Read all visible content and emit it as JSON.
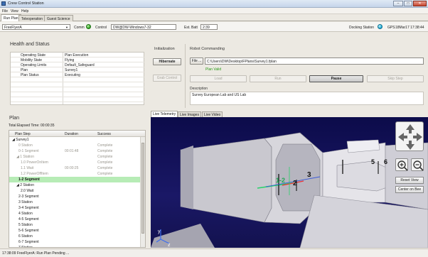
{
  "window": {
    "title": "Crew Control Station",
    "min": "–",
    "max": "□",
    "close": "✕"
  },
  "menu": [
    "File",
    "View",
    "Help"
  ],
  "tabs": [
    {
      "label": "Run Plan",
      "active": true
    },
    {
      "label": "Teleoperation",
      "active": false
    },
    {
      "label": "Guest Science",
      "active": false
    }
  ],
  "toolbar": {
    "robot_select": "FreeFlyerA",
    "comm_label": "Comm",
    "control_label": "Control",
    "control_value": "DW@DW-Windows7-32",
    "estbatt_label": "Est. Batt",
    "estbatt_value": "2:39",
    "docking_label": "Docking Station",
    "gps_label": "GPS",
    "gps_value": "18Mar17 17:38:44",
    "comm_color": "#2aa21a",
    "dock_color": "#13a7d4"
  },
  "health": {
    "title": "Health and Status",
    "rows": [
      {
        "label": "Operating State",
        "value": "Plan Execution"
      },
      {
        "label": "Mobility State",
        "value": "Flying"
      },
      {
        "label": "Operating Limits",
        "value": "Default_Safeguard"
      },
      {
        "label": "Plan",
        "value": "Survey1"
      },
      {
        "label": "Plan Status",
        "value": "Executing"
      }
    ]
  },
  "initialization": {
    "title": "Initialization",
    "hibernate": "Hibernate",
    "grab_control": "Grab Control"
  },
  "robot_cmd": {
    "title": "Robot Commanding",
    "file_button": "File ...",
    "file_path": "C:\\Users\\DW\\Desktop\\FPlans\\Survey1.fplan",
    "plan_valid": "Plan Valid",
    "buttons": {
      "load": "Load",
      "run": "Run",
      "pause": "Pause",
      "skip": "Skip Step"
    },
    "description_label": "Description",
    "description": "Survey European Lab and US Lab"
  },
  "plan": {
    "title": "Plan",
    "elapsed": "Total Elapsed Time: 00:00:35",
    "columns": [
      "Plan Step",
      "Duration",
      "Success"
    ],
    "rows": [
      {
        "step": "◢ Survey1",
        "duration": "",
        "success": "",
        "indent": 0,
        "grey": false,
        "sel": false
      },
      {
        "step": "0 Station",
        "duration": "",
        "success": "Complete",
        "indent": 3,
        "grey": true,
        "sel": false
      },
      {
        "step": "0-1 Segment",
        "duration": "00:01:48",
        "success": "Complete",
        "indent": 3,
        "grey": true,
        "sel": false
      },
      {
        "step": "◢ 1 Station",
        "duration": "",
        "success": "Complete",
        "indent": 2,
        "grey": true,
        "sel": false
      },
      {
        "step": "1.0 PowerOnItem",
        "duration": "",
        "success": "Complete",
        "indent": 4,
        "grey": true,
        "sel": false
      },
      {
        "step": "1.1 Wait",
        "duration": "00:00:25",
        "success": "Complete",
        "indent": 4,
        "grey": true,
        "sel": false
      },
      {
        "step": "1.2 PowerOffItem",
        "duration": "",
        "success": "Complete",
        "indent": 4,
        "grey": true,
        "sel": false
      },
      {
        "step": "1-2 Segment",
        "duration": "",
        "success": "",
        "indent": 3,
        "grey": false,
        "sel": true
      },
      {
        "step": "◢ 2 Station",
        "duration": "",
        "success": "",
        "indent": 2,
        "grey": false,
        "sel": false
      },
      {
        "step": "2.0 Wait",
        "duration": "",
        "success": "",
        "indent": 4,
        "grey": false,
        "sel": false
      },
      {
        "step": "2-3 Segment",
        "duration": "",
        "success": "",
        "indent": 3,
        "grey": false,
        "sel": false
      },
      {
        "step": "3 Station",
        "duration": "",
        "success": "",
        "indent": 3,
        "grey": false,
        "sel": false
      },
      {
        "step": "3-4 Segment",
        "duration": "",
        "success": "",
        "indent": 3,
        "grey": false,
        "sel": false
      },
      {
        "step": "4 Station",
        "duration": "",
        "success": "",
        "indent": 3,
        "grey": false,
        "sel": false
      },
      {
        "step": "4-5 Segment",
        "duration": "",
        "success": "",
        "indent": 3,
        "grey": false,
        "sel": false
      },
      {
        "step": "5 Station",
        "duration": "",
        "success": "",
        "indent": 3,
        "grey": false,
        "sel": false
      },
      {
        "step": "5-6 Segment",
        "duration": "",
        "success": "",
        "indent": 3,
        "grey": false,
        "sel": false
      },
      {
        "step": "6 Station",
        "duration": "",
        "success": "",
        "indent": 3,
        "grey": false,
        "sel": false
      },
      {
        "step": "6-7 Segment",
        "duration": "",
        "success": "",
        "indent": 3,
        "grey": false,
        "sel": false
      },
      {
        "step": "7 Station",
        "duration": "",
        "success": "",
        "indent": 3,
        "grey": false,
        "sel": false
      }
    ]
  },
  "view_tabs": [
    "Live Telemetry",
    "Live Images",
    "Live Video"
  ],
  "scene": {
    "markers": [
      "1-2",
      "2",
      "3",
      "5",
      "6"
    ],
    "reset_view": "Reset View",
    "center_on_bee": "Center on Bee",
    "axis_y": "y",
    "axis_z": "z"
  },
  "status_bar": "17:38:09 FreeFlyerA: Run Plan Pending ..."
}
